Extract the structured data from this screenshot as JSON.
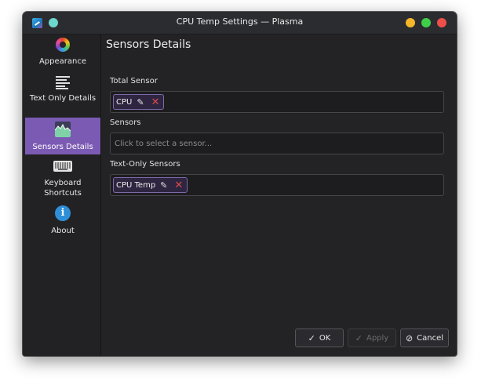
{
  "window": {
    "title": "CPU Temp Settings — Plasma",
    "accent": "#7b5ab4"
  },
  "sidebar": {
    "items": [
      {
        "label": "Appearance",
        "icon": "palette-icon",
        "active": false
      },
      {
        "label": "Text Only Details",
        "icon": "text-lines-icon",
        "active": false
      },
      {
        "label": "Sensors Details",
        "icon": "sensor-graph-icon",
        "active": true
      },
      {
        "label": "Keyboard\nShortcuts",
        "label_line1": "Keyboard",
        "label_line2": "Shortcuts",
        "icon": "keyboard-icon",
        "active": false
      },
      {
        "label": "About",
        "icon": "info-icon",
        "active": false
      }
    ]
  },
  "main": {
    "title": "Sensors Details",
    "total_sensor": {
      "label": "Total Sensor",
      "chips": [
        {
          "text": "CPU",
          "edit_icon": "pencil-icon",
          "remove_icon": "close-icon"
        }
      ]
    },
    "sensors": {
      "label": "Sensors",
      "placeholder": "Click to select a sensor..."
    },
    "text_only_sensors": {
      "label": "Text-Only Sensors",
      "chips": [
        {
          "text": "CPU Temp",
          "edit_icon": "pencil-icon",
          "remove_icon": "close-icon"
        }
      ]
    }
  },
  "footer": {
    "ok_label": "OK",
    "apply_label": "Apply",
    "cancel_label": "Cancel",
    "apply_disabled": true
  }
}
